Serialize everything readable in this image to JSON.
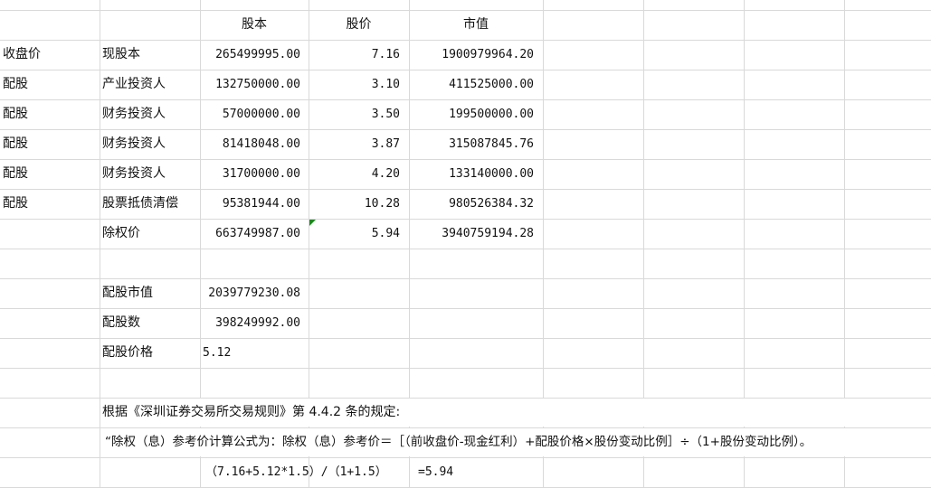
{
  "sheet": {
    "headers": {
      "shares": "股本",
      "price": "股价",
      "market_value": "市值"
    },
    "rows": [
      {
        "type": "收盘价",
        "name": "现股本",
        "shares": "265499995.00",
        "price": "7.16",
        "value": "1900979964.20"
      },
      {
        "type": "配股",
        "name": "产业投资人",
        "shares": "132750000.00",
        "price": "3.10",
        "value": "411525000.00"
      },
      {
        "type": "配股",
        "name": "财务投资人",
        "shares": "57000000.00",
        "price": "3.50",
        "value": "199500000.00"
      },
      {
        "type": "配股",
        "name": "财务投资人",
        "shares": "81418048.00",
        "price": "3.87",
        "value": "315087845.76"
      },
      {
        "type": "配股",
        "name": "财务投资人",
        "shares": "31700000.00",
        "price": "4.20",
        "value": "133140000.00"
      },
      {
        "type": "配股",
        "name": "股票抵债清偿",
        "shares": "95381944.00",
        "price": "10.28",
        "value": "980526384.32"
      },
      {
        "type": "",
        "name": "除权价",
        "shares": "663749987.00",
        "price": "5.94",
        "value": "3940759194.28"
      }
    ],
    "summary": [
      {
        "label": "配股市值",
        "value": "2039779230.08"
      },
      {
        "label": "配股数",
        "value": "398249992.00"
      },
      {
        "label": "配股价格",
        "value": "5.12"
      }
    ],
    "notes": {
      "rule": "根据《深圳证券交易所交易规则》第 4.4.2 条的规定:",
      "formula_text": "“除权（息）参考价计算公式为：除权（息）参考价＝［（前收盘价-现金红利）+配股价格×股份变动比例］÷（1+股份变动比例）。",
      "calc": "（7.16+5.12*1.5）/（1+1.5）",
      "result": "=5.94"
    },
    "colors": {
      "gridline": "#d9d9d9",
      "error_marker": "#1a8a1a"
    }
  }
}
